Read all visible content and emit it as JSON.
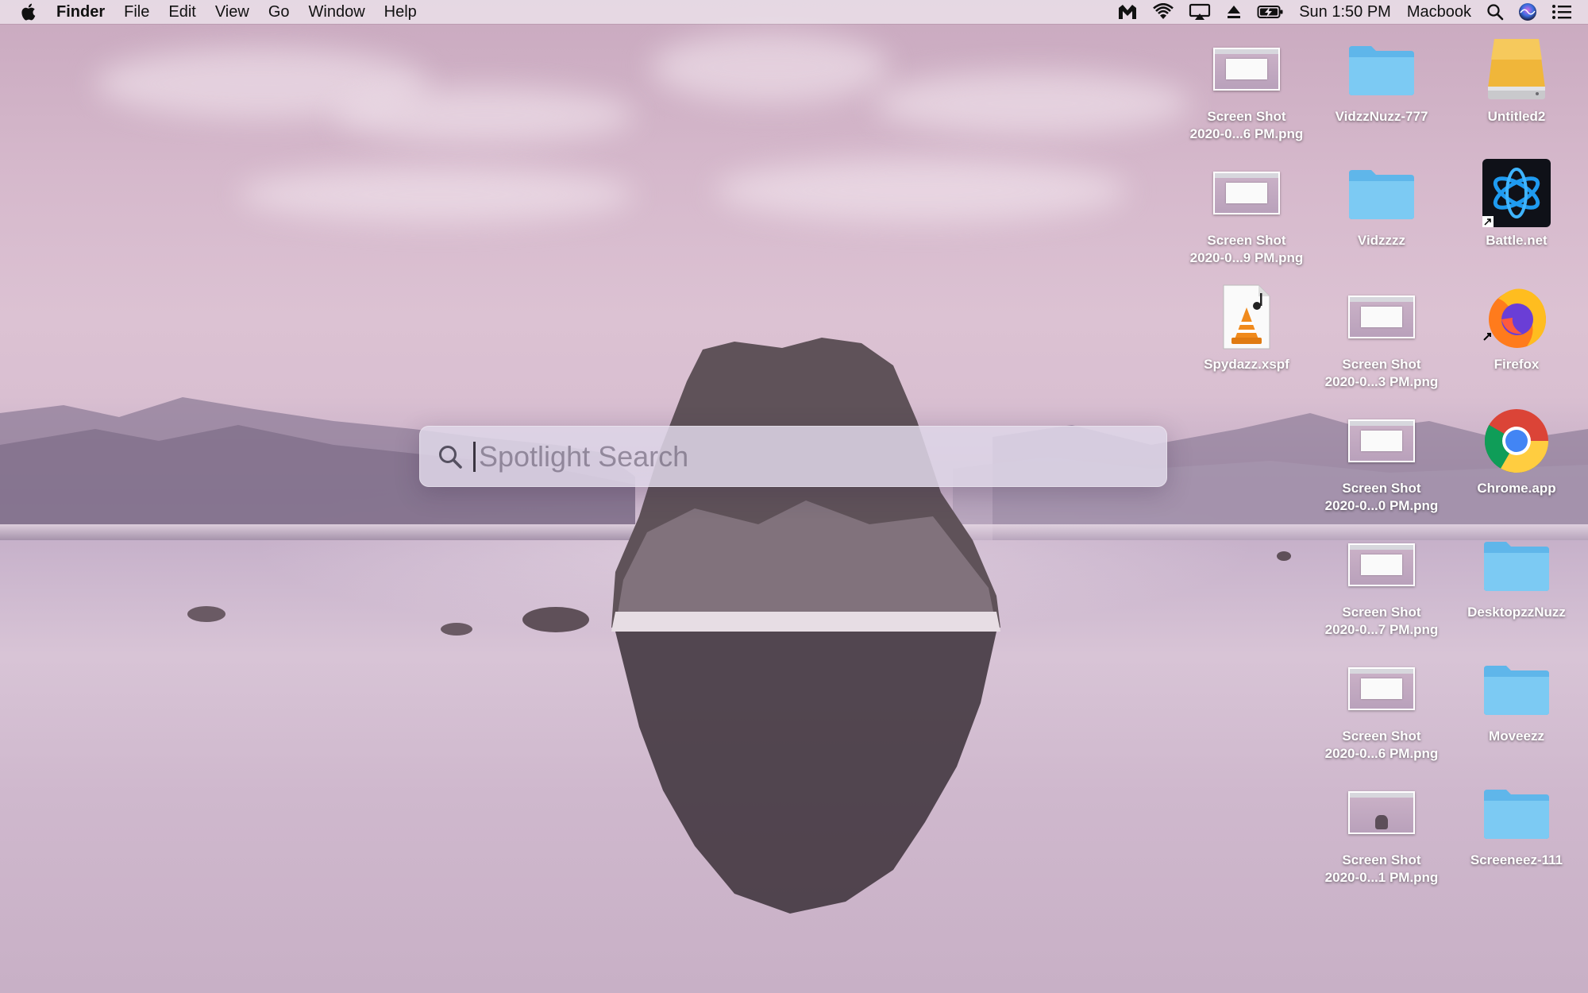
{
  "menubar": {
    "app_name": "Finder",
    "menus": [
      "File",
      "Edit",
      "View",
      "Go",
      "Window",
      "Help"
    ],
    "clock": "Sun 1:50 PM",
    "user": "Macbook"
  },
  "spotlight": {
    "placeholder": "Spotlight Search",
    "value": ""
  },
  "desktop": {
    "icons": [
      {
        "label_line1": "Screen Shot",
        "label_line2": "2020-0...6 PM.png",
        "type": "screenshot"
      },
      {
        "label_line1": "VidzzNuzz-777",
        "label_line2": "",
        "type": "folder"
      },
      {
        "label_line1": "Untitled2",
        "label_line2": "",
        "type": "drive"
      },
      {
        "label_line1": "Screen Shot",
        "label_line2": "2020-0...9 PM.png",
        "type": "screenshot"
      },
      {
        "label_line1": "Vidzzzz",
        "label_line2": "",
        "type": "folder"
      },
      {
        "label_line1": "Battle.net",
        "label_line2": "",
        "type": "battlenet-app"
      },
      {
        "label_line1": "Spydazz.xspf",
        "label_line2": "",
        "type": "vlc-playlist"
      },
      {
        "label_line1": "Screen Shot",
        "label_line2": "2020-0...3 PM.png",
        "type": "screenshot"
      },
      {
        "label_line1": "Firefox",
        "label_line2": "",
        "type": "firefox-app"
      },
      {
        "label_line1": "Screen Shot",
        "label_line2": "2020-0...0 PM.png",
        "type": "screenshot"
      },
      {
        "label_line1": "Chrome.app",
        "label_line2": "",
        "type": "chrome-app"
      },
      {
        "label_line1": "Screen Shot",
        "label_line2": "2020-0...7 PM.png",
        "type": "screenshot"
      },
      {
        "label_line1": "DesktopzzNuzz",
        "label_line2": "",
        "type": "folder"
      },
      {
        "label_line1": "Screen Shot",
        "label_line2": "2020-0...6 PM.png",
        "type": "screenshot"
      },
      {
        "label_line1": "Moveezz",
        "label_line2": "",
        "type": "folder"
      },
      {
        "label_line1": "Screen Shot",
        "label_line2": "2020-0...1 PM.png",
        "type": "screenshot"
      },
      {
        "label_line1": "Screeneez-111",
        "label_line2": "",
        "type": "folder"
      }
    ]
  },
  "colors": {
    "folder": "#6ec3f0",
    "drive": "#f0b63a",
    "menubar_bg": "#ece2ea"
  }
}
